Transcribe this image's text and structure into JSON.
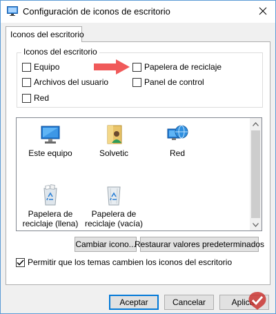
{
  "window": {
    "title": "Configuración de iconos de escritorio",
    "icon": "desktop-settings-icon",
    "accent_color": "#0078d7"
  },
  "tabs": [
    {
      "label": "Iconos del escritorio",
      "selected": true
    }
  ],
  "group": {
    "label": "Iconos del escritorio",
    "checkboxes": [
      {
        "label": "Equipo",
        "checked": false
      },
      {
        "label": "Papelera de reciclaje",
        "checked": false
      },
      {
        "label": "Archivos del usuario",
        "checked": false
      },
      {
        "label": "Panel de control",
        "checked": false
      },
      {
        "label": "Red",
        "checked": false
      }
    ]
  },
  "annotation": {
    "arrow_color": "#f05a5a",
    "icon": "red-arrow-icon"
  },
  "icon_list": {
    "items": [
      {
        "label": "Este equipo",
        "icon": "computer-icon"
      },
      {
        "label": "Solvetic",
        "icon": "user-folder-icon"
      },
      {
        "label": "Red",
        "icon": "network-globe-icon"
      },
      {
        "label": "Papelera de reciclaje (llena)",
        "icon": "recycle-bin-full-icon"
      },
      {
        "label": "Papelera de reciclaje (vacía)",
        "icon": "recycle-bin-empty-icon"
      }
    ]
  },
  "buttons": {
    "change_icon": "Cambiar icono...",
    "restore_defaults": "Restaurar valores predeterminados",
    "accept": "Aceptar",
    "cancel": "Cancelar",
    "apply": "Aplicar"
  },
  "theme_option": {
    "label": "Permitir que los temas cambien los iconos del escritorio",
    "checked": true
  },
  "watermark": {
    "icon": "solvetic-logo-icon"
  }
}
